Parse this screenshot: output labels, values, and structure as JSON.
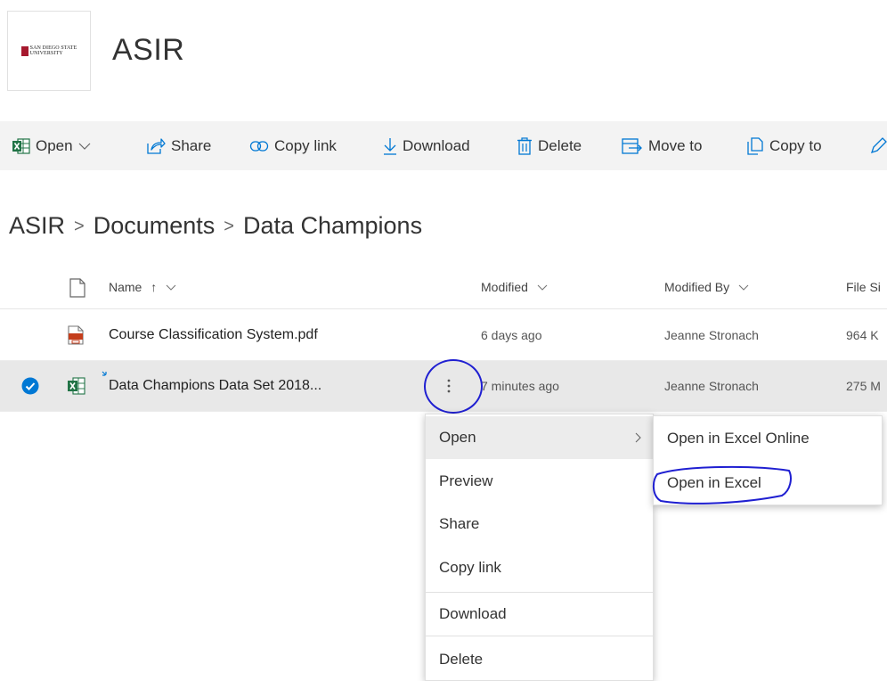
{
  "site": {
    "logo_text_line1": "SAN DIEGO STATE",
    "logo_text_line2": "UNIVERSITY",
    "title": "ASIR"
  },
  "commandbar": {
    "open": "Open",
    "share": "Share",
    "copy_link": "Copy link",
    "download": "Download",
    "delete": "Delete",
    "move_to": "Move to",
    "copy_to": "Copy to"
  },
  "breadcrumb": [
    "ASIR",
    "Documents",
    "Data Champions"
  ],
  "columns": {
    "name": "Name",
    "name_sort": "↑",
    "modified": "Modified",
    "modified_by": "Modified By",
    "file_size": "File Si"
  },
  "files": [
    {
      "name": "Course Classification System.pdf",
      "modified": "6 days ago",
      "modified_by": "Jeanne Stronach",
      "size": "964 K"
    },
    {
      "name": "Data Champions Data Set 2018...",
      "modified": "7 minutes ago",
      "modified_by": "Jeanne Stronach",
      "size": "275 M"
    }
  ],
  "context_menu": {
    "items": [
      "Open",
      "Preview",
      "Share",
      "Copy link",
      "Download",
      "Delete"
    ]
  },
  "open_submenu": {
    "items": [
      "Open in Excel Online",
      "Open in Excel"
    ]
  },
  "colors": {
    "selected_check": "#0078d4",
    "excel_green": "#217346",
    "pdf_red": "#c43e1c",
    "annotation_blue": "#1f1fd1"
  }
}
